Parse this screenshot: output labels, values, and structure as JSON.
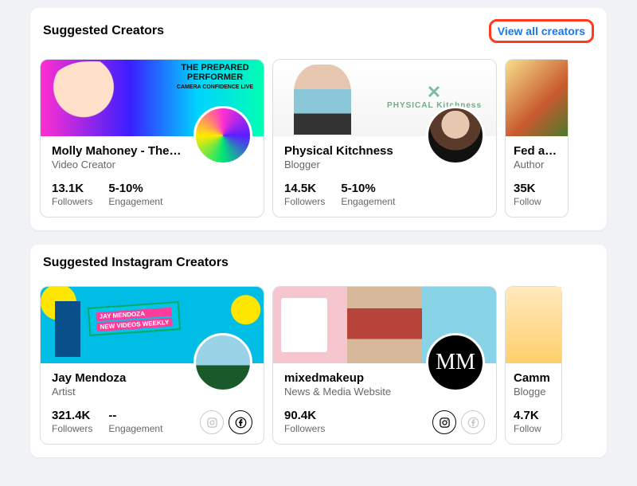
{
  "sections": {
    "creators": {
      "title": "Suggested Creators",
      "view_all_label": "View all creators"
    },
    "ig_creators": {
      "title": "Suggested Instagram Creators"
    }
  },
  "labels": {
    "followers": "Followers",
    "engagement": "Engagement"
  },
  "creators": [
    {
      "name": "Molly Mahoney - The…",
      "role": "Video Creator",
      "followers": "13.1K",
      "engagement": "5-10%",
      "banner_title": "THE PREPARED PERFORMER",
      "banner_sub": "CAMERA CONFIDENCE LIVE"
    },
    {
      "name": "Physical Kitchness",
      "role": "Blogger",
      "followers": "14.5K",
      "engagement": "5-10%",
      "brand": "PHYSICAL Kitchness"
    },
    {
      "name": "Fed a…",
      "role": "Author",
      "followers": "35K",
      "followers_label_trunc": "Follow"
    }
  ],
  "ig_creators": [
    {
      "name": "Jay Mendoza",
      "role": "Artist",
      "followers": "321.4K",
      "engagement": "--",
      "banner_title": "JAY MENDOZA",
      "banner_sub": "NEW VIDEOS WEEKLY"
    },
    {
      "name": "mixedmakeup",
      "role": "News & Media Website",
      "followers": "90.4K",
      "avatar_text": "MM"
    },
    {
      "name": "Camm",
      "role": "Blogge",
      "followers": "4.7K",
      "followers_label_trunc": "Follow"
    }
  ]
}
